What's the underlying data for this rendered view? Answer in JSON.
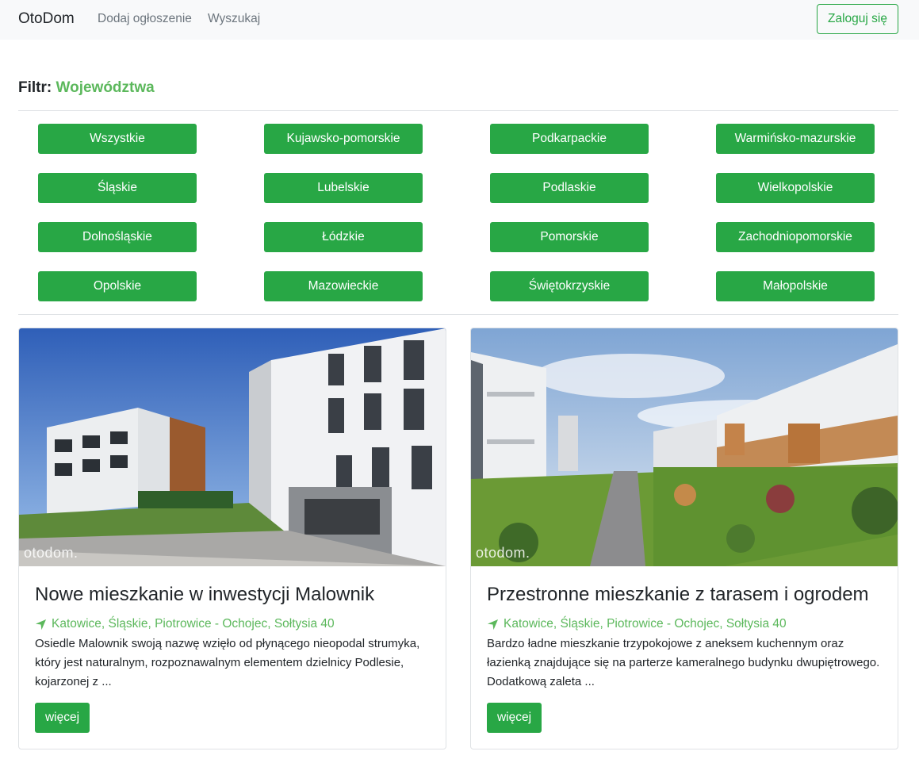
{
  "navbar": {
    "brand": "OtoDom",
    "links": [
      "Dodaj ogłoszenie",
      "Wyszukaj"
    ],
    "login_label": "Zaloguj się"
  },
  "filter": {
    "prefix": "Filtr:",
    "title": "Województwa",
    "regions": [
      "Wszystkie",
      "Kujawsko-pomorskie",
      "Podkarpackie",
      "Warmińsko-mazurskie",
      "Śląskie",
      "Lubelskie",
      "Podlaskie",
      "Wielkopolskie",
      "Dolnośląskie",
      "Łódzkie",
      "Pomorskie",
      "Zachodniopomorskie",
      "Opolskie",
      "Mazowieckie",
      "Świętokrzyskie",
      "Małopolskie"
    ]
  },
  "listings": [
    {
      "title": "Nowe mieszkanie w inwestycji Malownik",
      "location": "Katowice, Śląskie, Piotrowice - Ochojec, Sołtysia 40",
      "description": "Osiedle Malownik swoją nazwę wzięło od płynącego nieopodal strumyka, który jest naturalnym, rozpoznawalnym elementem dzielnicy Podlesie, kojarzonej z ...",
      "more_label": "więcej",
      "watermark": "otodom."
    },
    {
      "title": "Przestronne mieszkanie z tarasem i ogrodem",
      "location": "Katowice, Śląskie, Piotrowice - Ochojec, Sołtysia 40",
      "description": "Bardzo ładne mieszkanie trzypokojowe z aneksem kuchennym oraz łazienką znajdujące się na parterze kameralnego budynku dwupiętrowego. Dodatkową zaleta ...",
      "more_label": "więcej",
      "watermark": "otodom."
    }
  ],
  "colors": {
    "accent": "#28a745",
    "accent_text": "#5cb85c",
    "navbar_bg": "#f8f9fa"
  }
}
